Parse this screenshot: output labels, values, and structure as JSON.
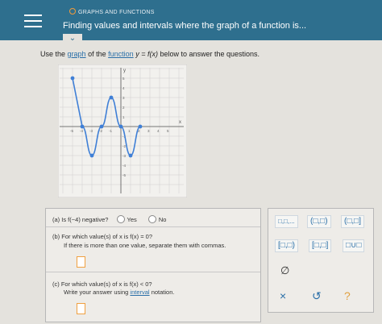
{
  "header": {
    "topic": "GRAPHS AND FUNCTIONS",
    "title": "Finding values and intervals where the graph of a function is..."
  },
  "question": {
    "prefix": "Use the",
    "link1": "graph",
    "middle": "of the",
    "link2": "function",
    "formula": "y = f(x)",
    "suffix": "below to answer the questions."
  },
  "graph": {
    "axis_x_label": "x",
    "axis_y_label": "y",
    "x_ticks": [
      "-5",
      "-4",
      "-3",
      "-2",
      "-1",
      "1",
      "2",
      "3",
      "4",
      "5"
    ],
    "y_ticks": [
      "5",
      "4",
      "3",
      "2",
      "1",
      "-1",
      "-2",
      "-3",
      "-4",
      "-5"
    ],
    "curve_points": [
      [
        -5,
        5
      ],
      [
        -4,
        0
      ],
      [
        -3,
        -3
      ],
      [
        -2,
        0
      ],
      [
        -1,
        3
      ],
      [
        0,
        0
      ],
      [
        1,
        -3
      ],
      [
        2,
        0
      ]
    ]
  },
  "parts": {
    "a": {
      "label": "(a)",
      "text": "Is f(−4) negative?",
      "opt_yes": "Yes",
      "opt_no": "No"
    },
    "b": {
      "label": "(b)",
      "text": "For which value(s) of x is f(x) = 0?",
      "hint": "If there is more than one value, separate them with commas."
    },
    "c": {
      "label": "(c)",
      "text": "For which value(s) of x is f(x) < 0?",
      "hint_prefix": "Write your answer using",
      "hint_link": "interval",
      "hint_suffix": "notation."
    }
  },
  "tools": {
    "t1": "□,□,...",
    "t2": "(□,□)",
    "t3": "(□,□]",
    "t4": "[□,□)",
    "t5": "[□,□]",
    "t6": "□∪□",
    "empty": "∅",
    "clear": "×",
    "undo": "↺",
    "help": "?"
  }
}
